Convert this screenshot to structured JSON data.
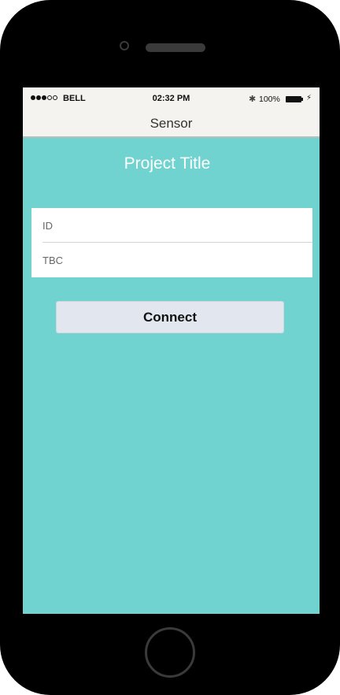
{
  "status_bar": {
    "carrier": "BELL",
    "time": "02:32 PM",
    "battery_percent": "100%",
    "signal_bars_filled": 3,
    "signal_bars_total": 5,
    "bluetooth_glyph": "✱",
    "charge_glyph": "⚡"
  },
  "nav": {
    "title": "Sensor"
  },
  "main": {
    "title": "Project Title",
    "fields": [
      {
        "placeholder": "ID"
      },
      {
        "placeholder": "TBC"
      }
    ],
    "connect_label": "Connect"
  },
  "colors": {
    "screen_background": "#70d3cf",
    "bar_background": "#f5f3ef",
    "button_background": "#e1e6ef"
  },
  "icons": {
    "bluetooth": "bluetooth-icon",
    "battery": "battery-icon",
    "charging": "charging-icon"
  }
}
